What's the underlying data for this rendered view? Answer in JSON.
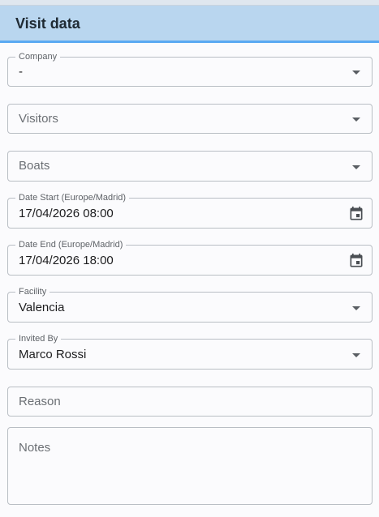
{
  "header": {
    "title": "Visit data"
  },
  "fields": {
    "company": {
      "label": "Company",
      "value": "-"
    },
    "visitors": {
      "placeholder": "Visitors"
    },
    "boats": {
      "placeholder": "Boats"
    },
    "date_start": {
      "label": "Date Start (Europe/Madrid)",
      "value": "17/04/2026 08:00"
    },
    "date_end": {
      "label": "Date End (Europe/Madrid)",
      "value": "17/04/2026 18:00"
    },
    "facility": {
      "label": "Facility",
      "value": "Valencia"
    },
    "invited_by": {
      "label": "Invited By",
      "value": "Marco Rossi"
    },
    "reason": {
      "placeholder": "Reason"
    },
    "notes": {
      "placeholder": "Notes"
    }
  },
  "icons": {
    "dropdown": "chevron-down-icon",
    "calendar": "calendar-icon"
  },
  "colors": {
    "header_bg": "#b9d6ef",
    "header_accent": "#5aa9f2",
    "field_border": "#b9bec4"
  }
}
